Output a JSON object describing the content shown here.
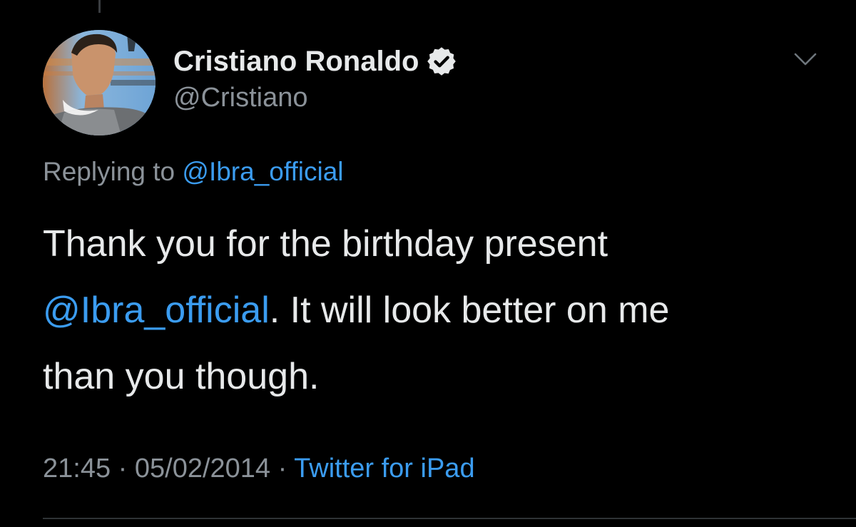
{
  "author": {
    "display_name": "Cristiano Ronaldo",
    "handle": "@Cristiano",
    "verified": true
  },
  "reply": {
    "prefix": "Replying to",
    "mention": "@Ibra_official"
  },
  "tweet": {
    "line1": "Thank you for the birthday present",
    "mention": "@Ibra_official",
    "line2_rest": ". It will look better on me",
    "line3": "than you though."
  },
  "meta": {
    "time": "21:45",
    "separator1": " · ",
    "date": "05/02/2014",
    "separator2": " · ",
    "source": "Twitter for iPad"
  },
  "icons": {
    "verified": "verified-badge-icon",
    "menu": "chevron-down-icon"
  },
  "colors": {
    "background": "#000000",
    "text": "#e7e9ea",
    "secondary": "#8b9299",
    "link": "#3b9cf0"
  }
}
